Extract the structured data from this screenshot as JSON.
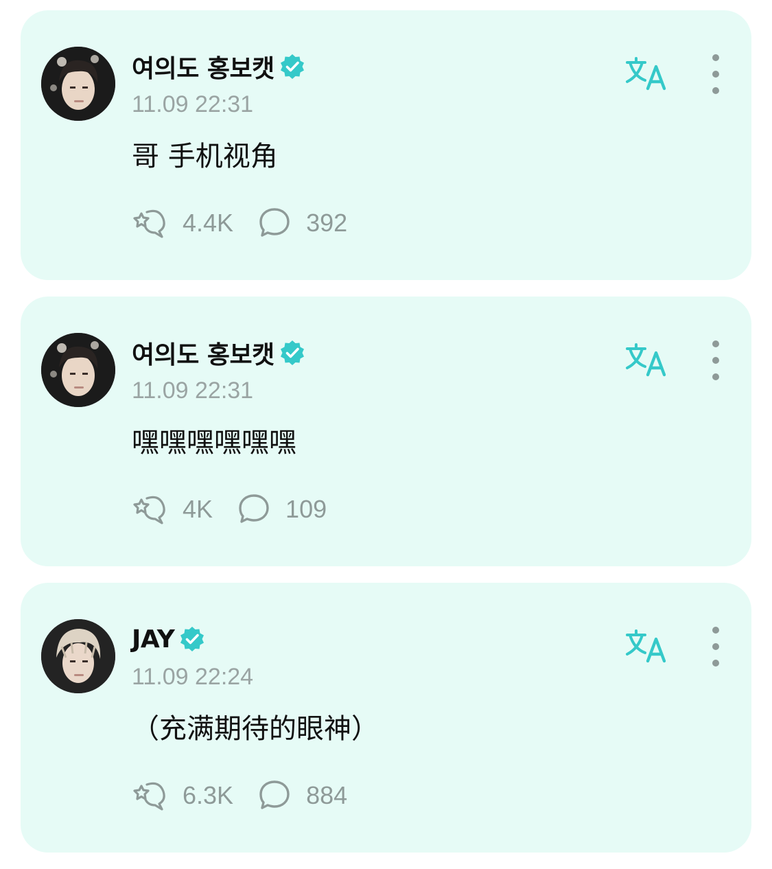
{
  "colors": {
    "card_bg": "#e6fbf6",
    "accent": "#35c9c9",
    "muted": "#8e9a98",
    "text": "#111111"
  },
  "icons": {
    "verified": "verified-badge-icon",
    "translate": "translate-icon",
    "more": "more-vertical-icon",
    "like": "star-hand-icon",
    "comment": "speech-bubble-icon"
  },
  "posts": [
    {
      "author": "여의도 홍보캣",
      "verified": true,
      "time": "11.09 22:31",
      "content": "哥 手机视角",
      "likes": "4.4K",
      "comments": "392"
    },
    {
      "author": "여의도 홍보캣",
      "verified": true,
      "time": "11.09 22:31",
      "content": "嘿嘿嘿嘿嘿嘿",
      "likes": "4K",
      "comments": "109"
    },
    {
      "author": "JAY",
      "verified": true,
      "time": "11.09 22:24",
      "content": "（充满期待的眼神）",
      "likes": "6.3K",
      "comments": "884"
    }
  ]
}
